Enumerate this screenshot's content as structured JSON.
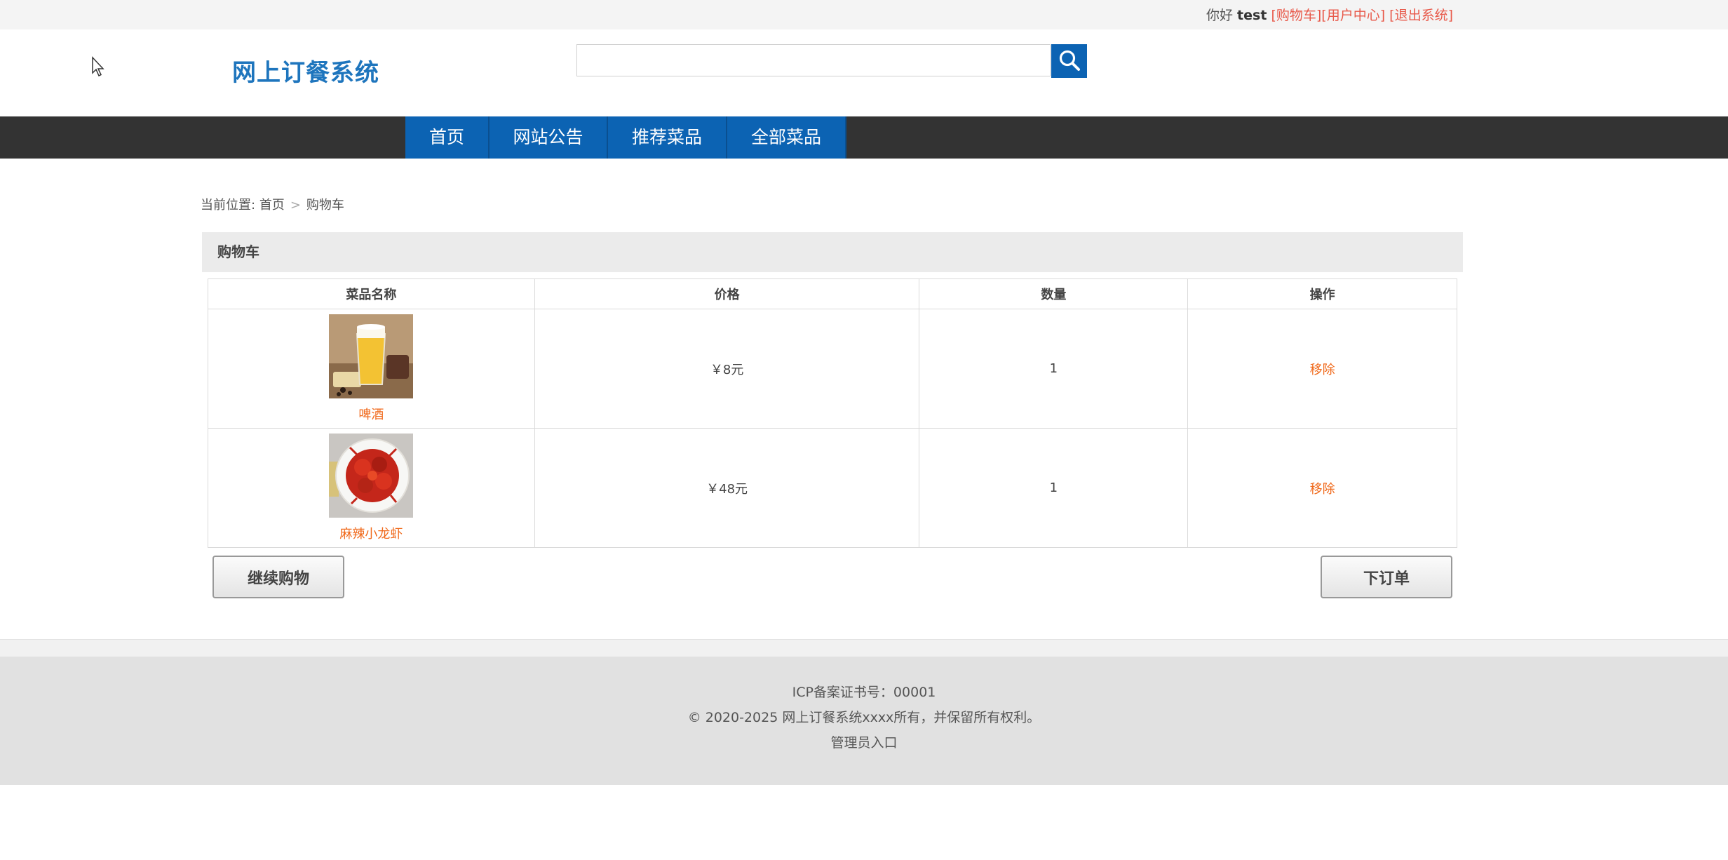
{
  "topbar": {
    "greeting": "你好",
    "username": "test",
    "cart_link": "[购物车]",
    "user_center_link": "[用户中心]",
    "logout_link": "[退出系统]"
  },
  "header": {
    "logo": "网上订餐系统",
    "search_value": ""
  },
  "nav": {
    "items": [
      "首页",
      "网站公告",
      "推荐菜品",
      "全部菜品"
    ]
  },
  "breadcrumb": {
    "prefix": "当前位置:",
    "home": "首页",
    "current": "购物车"
  },
  "cart": {
    "title": "购物车",
    "columns": [
      "菜品名称",
      "价格",
      "数量",
      "操作"
    ],
    "rows": [
      {
        "name": "啤酒",
        "price": "￥8元",
        "qty": "1",
        "action": "移除"
      },
      {
        "name": "麻辣小龙虾",
        "price": "￥48元",
        "qty": "1",
        "action": "移除"
      }
    ],
    "continue_label": "继续购物",
    "order_label": "下订单"
  },
  "footer": {
    "icp": "ICP备案证书号：00001",
    "copyright": "© 2020-2025 网上订餐系统xxxx所有，并保留所有权利。",
    "admin_link": "管理员入口"
  },
  "colors": {
    "brand_blue": "#0c63b3",
    "nav_dark": "#333333",
    "link_orange": "#f06a1c",
    "topbar_link_red": "#e8594a"
  }
}
